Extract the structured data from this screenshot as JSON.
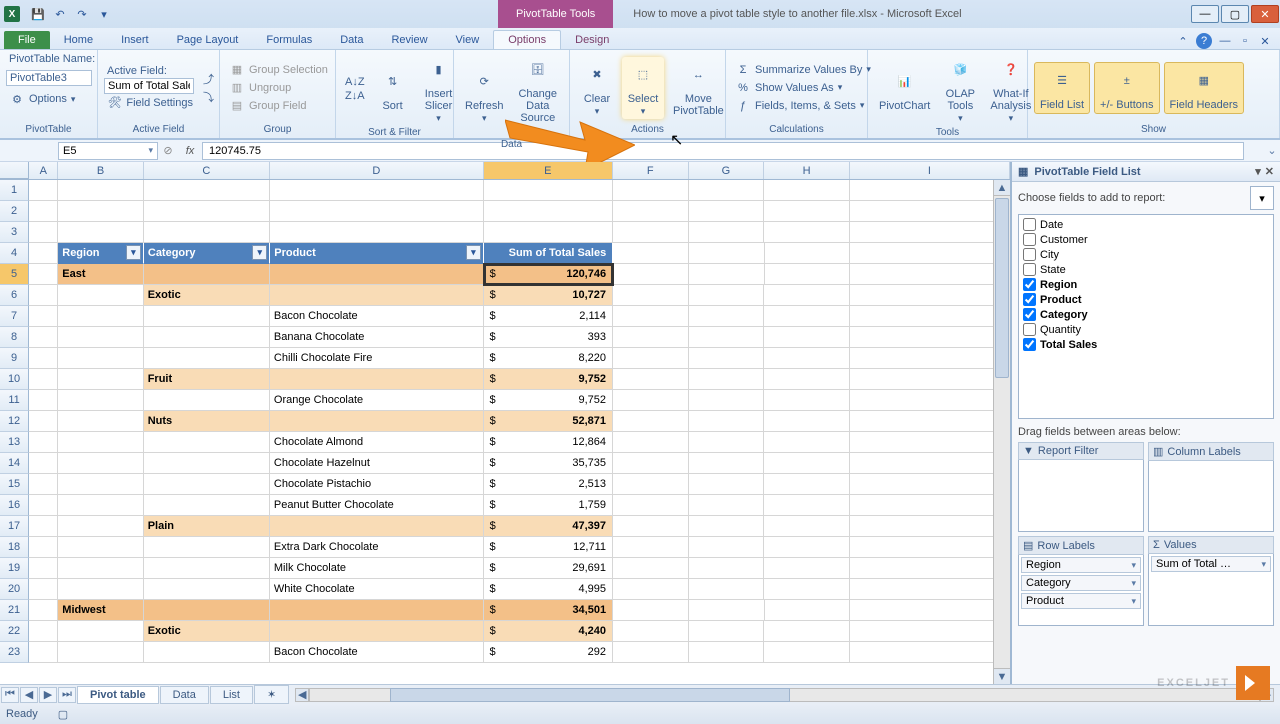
{
  "titlebar": {
    "context_tab": "PivotTable Tools",
    "title": "How to move a pivot table style to another file.xlsx - Microsoft Excel"
  },
  "tabs": {
    "file": "File",
    "list": [
      "Home",
      "Insert",
      "Page Layout",
      "Formulas",
      "Data",
      "Review",
      "View"
    ],
    "context_tabs": [
      "Options",
      "Design"
    ],
    "active": "Options"
  },
  "ribbon": {
    "pivottable_name_label": "PivotTable Name:",
    "pivottable_name_value": "PivotTable3",
    "options_btn": "Options",
    "group1_label": "PivotTable",
    "activefield_label": "Active Field:",
    "activefield_value": "Sum of Total Sales",
    "field_settings": "Field Settings",
    "group2_label": "Active Field",
    "group_selection": "Group Selection",
    "ungroup": "Ungroup",
    "group_field": "Group Field",
    "group3_label": "Group",
    "sort": "Sort",
    "insert_slicer": "Insert Slicer",
    "group4_label": "Sort & Filter",
    "refresh": "Refresh",
    "change_data_source": "Change Data Source",
    "group5_label": "Data",
    "clear": "Clear",
    "select": "Select",
    "move_pt": "Move PivotTable",
    "group6_label": "Actions",
    "summarize": "Summarize Values By",
    "show_values": "Show Values As",
    "fields_items": "Fields, Items, & Sets",
    "group7_label": "Calculations",
    "pivotchart": "PivotChart",
    "olap": "OLAP Tools",
    "whatif": "What-If Analysis",
    "group8_label": "Tools",
    "field_list": "Field List",
    "buttons": "+/- Buttons",
    "field_headers": "Field Headers",
    "group9_label": "Show"
  },
  "namebox": "E5",
  "formula": "120745.75",
  "columns": [
    "A",
    "B",
    "C",
    "D",
    "E",
    "F",
    "G",
    "H",
    "I"
  ],
  "pivot": {
    "headers": {
      "region": "Region",
      "category": "Category",
      "product": "Product",
      "value": "Sum of Total Sales"
    },
    "rows": [
      {
        "n": 5,
        "type": "r1",
        "region": "East",
        "currency": "$",
        "value": "120,746",
        "active": true
      },
      {
        "n": 6,
        "type": "r2",
        "category": "Exotic",
        "currency": "$",
        "value": "10,727"
      },
      {
        "n": 7,
        "type": "r3",
        "product": "Bacon Chocolate",
        "currency": "$",
        "value": "2,114"
      },
      {
        "n": 8,
        "type": "r3",
        "product": "Banana Chocolate",
        "currency": "$",
        "value": "393"
      },
      {
        "n": 9,
        "type": "r3",
        "product": "Chilli Chocolate Fire",
        "currency": "$",
        "value": "8,220"
      },
      {
        "n": 10,
        "type": "r2",
        "category": "Fruit",
        "currency": "$",
        "value": "9,752"
      },
      {
        "n": 11,
        "type": "r3",
        "product": "Orange Chocolate",
        "currency": "$",
        "value": "9,752"
      },
      {
        "n": 12,
        "type": "r2",
        "category": "Nuts",
        "currency": "$",
        "value": "52,871"
      },
      {
        "n": 13,
        "type": "r3",
        "product": "Chocolate Almond",
        "currency": "$",
        "value": "12,864"
      },
      {
        "n": 14,
        "type": "r3",
        "product": "Chocolate Hazelnut",
        "currency": "$",
        "value": "35,735"
      },
      {
        "n": 15,
        "type": "r3",
        "product": "Chocolate Pistachio",
        "currency": "$",
        "value": "2,513"
      },
      {
        "n": 16,
        "type": "r3",
        "product": "Peanut Butter Chocolate",
        "currency": "$",
        "value": "1,759"
      },
      {
        "n": 17,
        "type": "r2",
        "category": "Plain",
        "currency": "$",
        "value": "47,397"
      },
      {
        "n": 18,
        "type": "r3",
        "product": "Extra Dark Chocolate",
        "currency": "$",
        "value": "12,711"
      },
      {
        "n": 19,
        "type": "r3",
        "product": "Milk Chocolate",
        "currency": "$",
        "value": "29,691"
      },
      {
        "n": 20,
        "type": "r3",
        "product": "White Chocolate",
        "currency": "$",
        "value": "4,995"
      },
      {
        "n": 21,
        "type": "r1",
        "region": "Midwest",
        "currency": "$",
        "value": "34,501"
      },
      {
        "n": 22,
        "type": "r2",
        "category": "Exotic",
        "currency": "$",
        "value": "4,240"
      },
      {
        "n": 23,
        "type": "r3",
        "product": "Bacon Chocolate",
        "currency": "$",
        "value": "292"
      }
    ]
  },
  "pane": {
    "title": "PivotTable Field List",
    "choose_label": "Choose fields to add to report:",
    "fields": [
      {
        "name": "Date",
        "checked": false
      },
      {
        "name": "Customer",
        "checked": false
      },
      {
        "name": "City",
        "checked": false
      },
      {
        "name": "State",
        "checked": false
      },
      {
        "name": "Region",
        "checked": true
      },
      {
        "name": "Product",
        "checked": true
      },
      {
        "name": "Category",
        "checked": true
      },
      {
        "name": "Quantity",
        "checked": false
      },
      {
        "name": "Total Sales",
        "checked": true
      }
    ],
    "drag_label": "Drag fields between areas below:",
    "areas": {
      "report_filter": "Report Filter",
      "column_labels": "Column Labels",
      "row_labels": "Row Labels",
      "values": "Values",
      "row_items": [
        "Region",
        "Category",
        "Product"
      ],
      "value_items": [
        "Sum of Total …"
      ]
    }
  },
  "sheettabs": {
    "active": "Pivot table",
    "others": [
      "Data",
      "List"
    ]
  },
  "status": "Ready",
  "watermark": "EXCELJET"
}
